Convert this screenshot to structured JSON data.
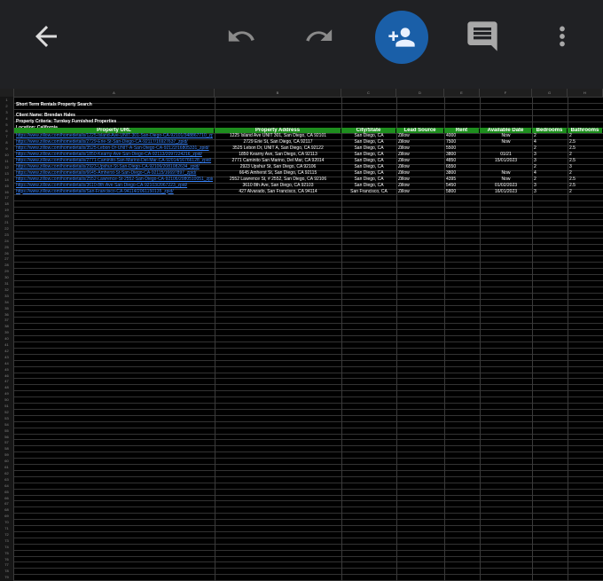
{
  "toolbar": {
    "back": "arrow-left-icon",
    "undo": "undo-icon",
    "redo": "redo-icon",
    "share": "add-person-icon",
    "comment": "comment-icon",
    "more": "more-vert-icon",
    "share_color": "#1a5fa8"
  },
  "sheet": {
    "columns": [
      "A",
      "B",
      "C",
      "D",
      "E",
      "F",
      "G",
      "H"
    ],
    "title": "Short Term Rentals Property Search",
    "client": "Client Name: Brendan Hales",
    "criteria": "Property Criteria: Turnkey Furnished Properties",
    "location": "Location: California",
    "headers": [
      "Property URL",
      "Property Address",
      "City/State",
      "Lead Source",
      "Rent",
      "Available Date",
      "Bedrooms",
      "Bathrooms"
    ],
    "header_color": "#1e8e1e",
    "rows": [
      {
        "url": "https://www.zillow.com/homedetails/1225-Island-Ave-UNIT-301-San-Diego-CA-92101/348867710_zpid/",
        "address": "1225 Island Ave UNIT 301, San Diego, CA 92101",
        "city": "San Diego, CA",
        "source": "Zillow",
        "rent": "4000",
        "date": "Now",
        "beds": "2",
        "baths": "2"
      },
      {
        "url": "https://www.zillow.com/homedetails/2729-Erie-St-San-Diego-CA-92117/16927637_zpid/",
        "address": "2729 Erie St, San Diego, CA 92117",
        "city": "San Diego, CA",
        "source": "Zillow",
        "rent": "7500",
        "date": "Now",
        "beds": "4",
        "baths": "2.5"
      },
      {
        "url": "https://www.zillow.com/homedetails/3525-Lebon-Dr-UNIT-A-San-Diego-CA-92122/16805331_zpid/",
        "address": "3525 Lebon Dr, UNIT A, San Diego, CA 92122",
        "city": "San Diego, CA",
        "source": "Zillow",
        "rent": "5500",
        "date": "",
        "beds": "2",
        "baths": "2.5"
      },
      {
        "url": "https://www.zillow.com/homedetails/1850-Kearny-Ave-San-Diego-CA-92113/2097224216_zpid/",
        "address": "1850 Kearny Ave, San Diego, CA 92113",
        "city": "San Diego, CA",
        "source": "Zillow",
        "rent": "3800",
        "date": "01/21",
        "beds": "3",
        "baths": "2"
      },
      {
        "url": "https://www.zillow.com/homedetails/2771-Caminito-San-Marino-Del-Mar-CA-92014/16766128_zpid/",
        "address": "2771 Caminito San Marino, Del Mar, CA 92014",
        "city": "San Diego, CA",
        "source": "Zillow",
        "rent": "4850",
        "date": "15/01/2023",
        "beds": "3",
        "baths": "2.5"
      },
      {
        "url": "https://www.zillow.com/homedetails/2923-Upshur-St-San-Diego-CA-92106/2081082634_zpid/",
        "address": "2923 Upshur St, San Diego, CA 92106",
        "city": "San Diego, CA",
        "source": "Zillow",
        "rent": "6550",
        "date": "",
        "beds": "2",
        "baths": "3"
      },
      {
        "url": "https://www.zillow.com/homedetails/6645-Amherst-St-San-Diego-CA-92115/16697897_zpid/",
        "address": "6645 Amherst St, San Diego, CA 92115",
        "city": "San Diego, CA",
        "source": "Zillow",
        "rent": "3800",
        "date": "Now",
        "beds": "4",
        "baths": "2"
      },
      {
        "url": "https://www.zillow.com/homedetails/2552-Lawrence-St-2552-San-Diego-CA-92106/2080510051_zpid/",
        "address": "2552 Lawrence St, # 2552, San Diego, CA 92106",
        "city": "San Diego, CA",
        "source": "Zillow",
        "rent": "4395",
        "date": "Now",
        "beds": "2",
        "baths": "2.5"
      },
      {
        "url": "https://www.zillow.com/homedetails/3610-8th-Ave-San-Diego-CA-92103/2067223_zpid/",
        "address": "3610 8th Ave, San Diego, CA 92103",
        "city": "San Diego, CA",
        "source": "Zillow",
        "rent": "5450",
        "date": "01/02/2023",
        "beds": "3",
        "baths": "2.5"
      },
      {
        "url": "https://www.zillow.com/homedetails/San-Francisco-CA-94114/2061150135_zpid/",
        "address": "427 Alvarado, San Francisco, CA 94114",
        "city": "San Francisco, CA",
        "source": "Zillow",
        "rent": "5800",
        "date": "16/01/2023",
        "beds": "3",
        "baths": "2"
      }
    ]
  }
}
